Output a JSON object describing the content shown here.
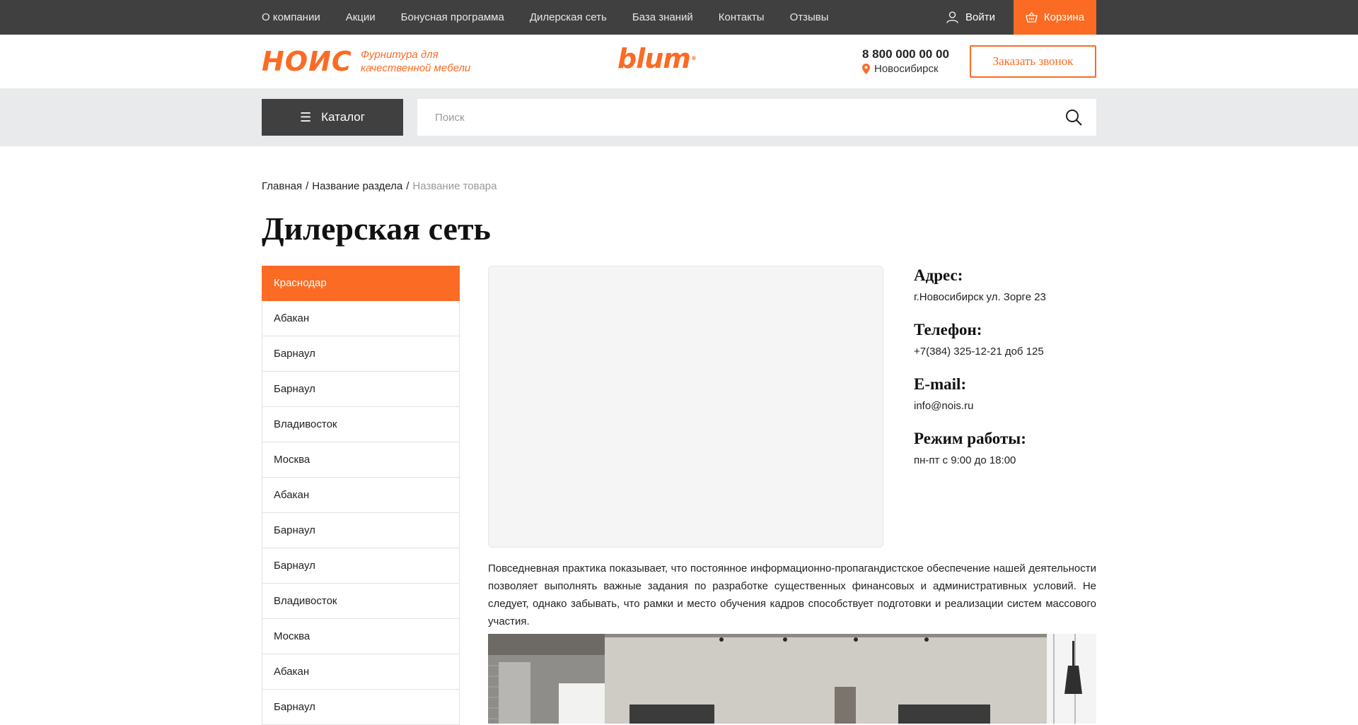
{
  "topnav": {
    "items": [
      "О компании",
      "Акции",
      "Бонусная программа",
      "Дилерская сеть",
      "База знаний",
      "Контакты",
      "Отзывы"
    ],
    "login_label": "Войти",
    "cart_label": "Корзина"
  },
  "header": {
    "logo_text": "НОИС",
    "tagline": "Фурнитура для качественной мебели",
    "brand": "blum",
    "brand_mark": "®",
    "phone": "8 800 000 00 00",
    "city": "Новосибирск",
    "callback_label": "Заказать звонок"
  },
  "search": {
    "catalog_label": "Каталог",
    "placeholder": "Поиск"
  },
  "breadcrumb": {
    "items": [
      "Главная",
      "Название раздела"
    ],
    "current": "Название товара",
    "separator": "/"
  },
  "page_title": "Дилерская сеть",
  "cities": [
    "Краснодар",
    "Абакан",
    "Барнаул",
    "Барнаул",
    "Владивосток",
    "Москва",
    "Абакан",
    "Барнаул",
    "Барнаул",
    "Владивосток",
    "Москва",
    "Абакан",
    "Барнаул"
  ],
  "active_city_index": 0,
  "contacts": {
    "address_label": "Адрес:",
    "address": "г.Новосибирск ул. Зорге 23",
    "phone_label": "Телефон:",
    "phone": "+7(384) 325-12-21 доб 125",
    "email_label": "E-mail:",
    "email": "info@nois.ru",
    "hours_label": "Режим работы:",
    "hours": "пн-пт с 9:00 до 18:00"
  },
  "description": "Повседневная практика показывает, что постоянное информационно-пропагандистское обеспечение нашей деятельности позволяет выполнять важные задания по разработке существенных финансовых и административных условий. Не следует, однако забывать, что рамки и место обучения кадров способствует подготовки и реализации систем массового участия.",
  "colors": {
    "accent": "#fb6b24",
    "dark": "#404040",
    "band": "#e9eaeb"
  }
}
